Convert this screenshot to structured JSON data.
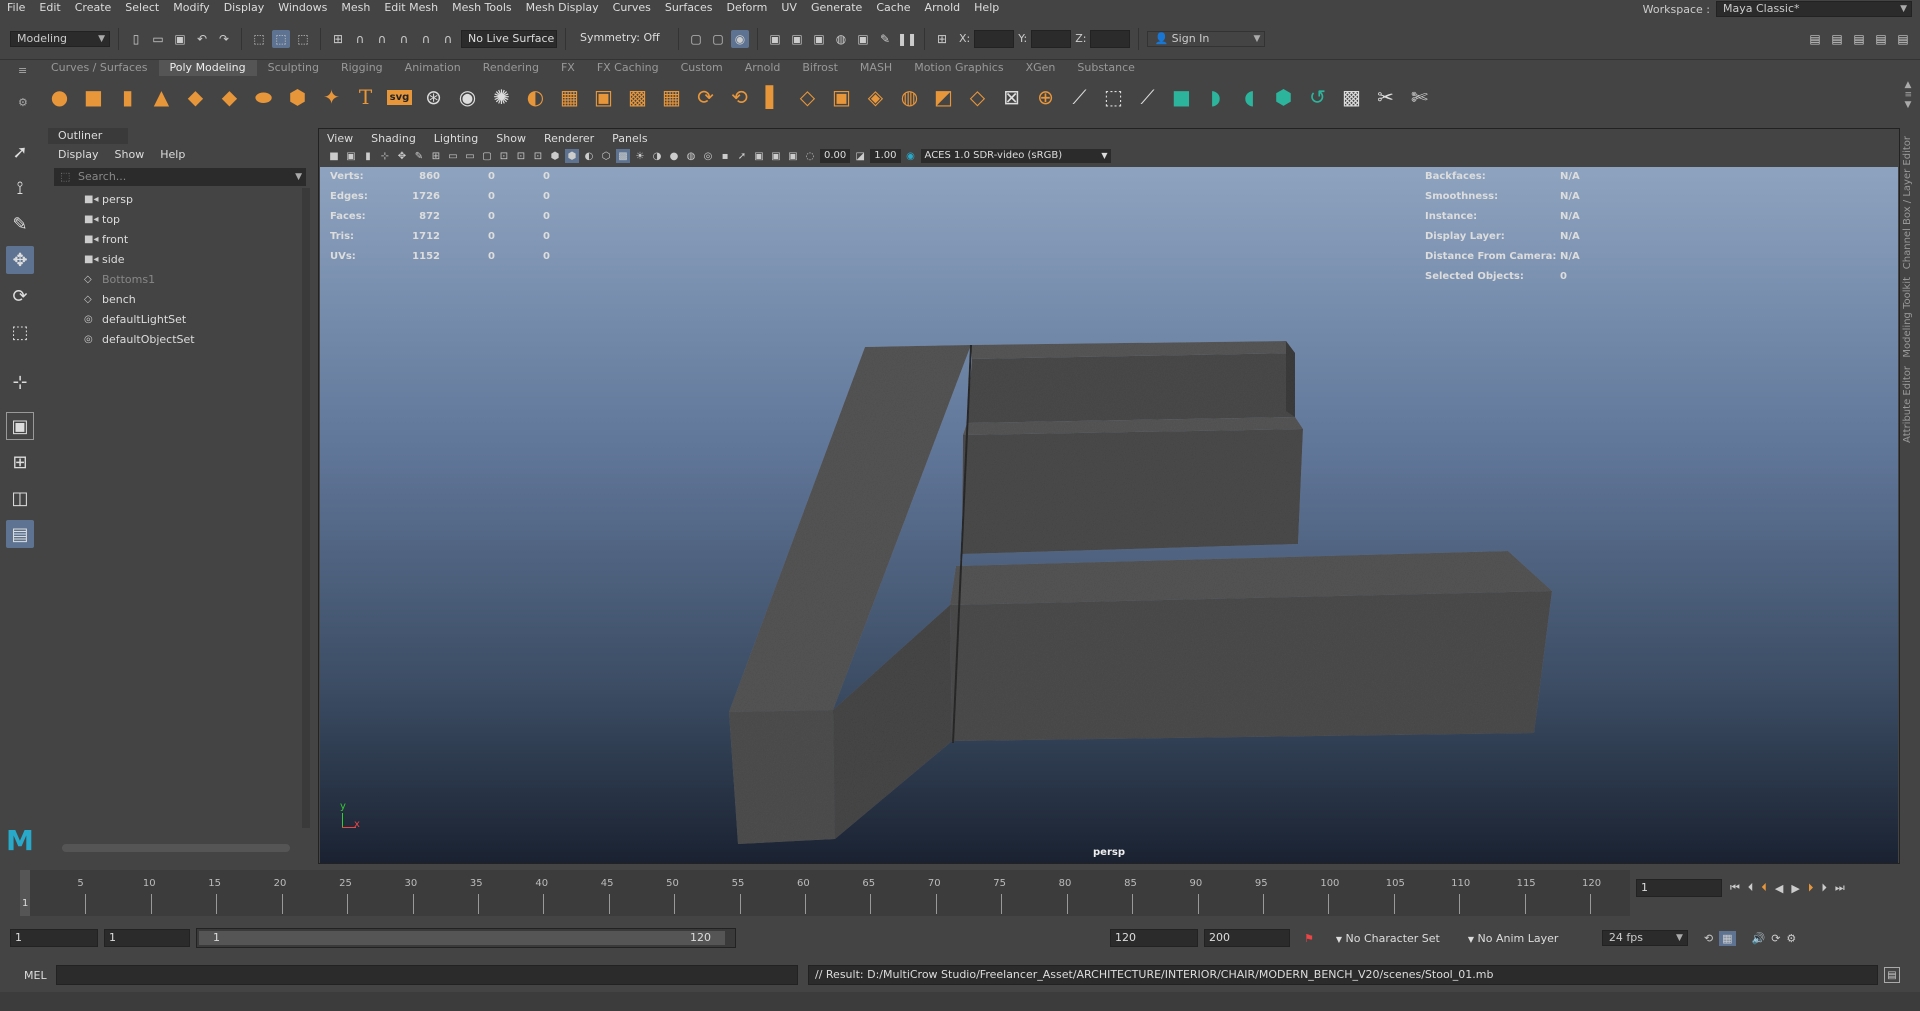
{
  "menubar": {
    "items": [
      "File",
      "Edit",
      "Create",
      "Select",
      "Modify",
      "Display",
      "Windows",
      "Mesh",
      "Edit Mesh",
      "Mesh Tools",
      "Mesh Display",
      "Curves",
      "Surfaces",
      "Deform",
      "UV",
      "Generate",
      "Cache",
      "Arnold",
      "Help"
    ],
    "workspace_label": "Workspace :",
    "workspace_value": "Maya Classic*"
  },
  "statusline": {
    "mode": "Modeling",
    "live_surface": "No Live Surface",
    "symmetry": "Symmetry: Off",
    "x_label": "X:",
    "y_label": "Y:",
    "z_label": "Z:",
    "sign_in": "Sign In"
  },
  "shelf": {
    "tabs": [
      "Curves / Surfaces",
      "Poly Modeling",
      "Sculpting",
      "Rigging",
      "Animation",
      "Rendering",
      "FX",
      "FX Caching",
      "Custom",
      "Arnold",
      "Bifrost",
      "MASH",
      "Motion Graphics",
      "XGen",
      "Substance"
    ],
    "active_tab": "Poly Modeling",
    "svg_label": "svg"
  },
  "outliner": {
    "title": "Outliner",
    "menu": [
      "Display",
      "Show",
      "Help"
    ],
    "search_placeholder": "Search...",
    "items": [
      {
        "label": "persp",
        "icon": "camera-icon",
        "dim": false
      },
      {
        "label": "top",
        "icon": "camera-icon",
        "dim": false
      },
      {
        "label": "front",
        "icon": "camera-icon",
        "dim": false
      },
      {
        "label": "side",
        "icon": "camera-icon",
        "dim": false
      },
      {
        "label": "Bottoms1",
        "icon": "group-icon",
        "dim": true
      },
      {
        "label": "bench",
        "icon": "group-icon",
        "dim": false
      },
      {
        "label": "defaultLightSet",
        "icon": "set-icon",
        "dim": false
      },
      {
        "label": "defaultObjectSet",
        "icon": "set-icon",
        "dim": false
      }
    ]
  },
  "viewport": {
    "menu": [
      "View",
      "Shading",
      "Lighting",
      "Show",
      "Renderer",
      "Panels"
    ],
    "exposure": "0.00",
    "gamma": "1.00",
    "colorspace": "ACES 1.0 SDR-video (sRGB)",
    "camera_label": "persp",
    "hud_left": [
      {
        "label": "Verts:",
        "v1": "860",
        "v2": "0",
        "v3": "0"
      },
      {
        "label": "Edges:",
        "v1": "1726",
        "v2": "0",
        "v3": "0"
      },
      {
        "label": "Faces:",
        "v1": "872",
        "v2": "0",
        "v3": "0"
      },
      {
        "label": "Tris:",
        "v1": "1712",
        "v2": "0",
        "v3": "0"
      },
      {
        "label": "UVs:",
        "v1": "1152",
        "v2": "0",
        "v3": "0"
      }
    ],
    "hud_right": [
      {
        "label": "Backfaces:",
        "value": "N/A"
      },
      {
        "label": "Smoothness:",
        "value": "N/A"
      },
      {
        "label": "Instance:",
        "value": "N/A"
      },
      {
        "label": "Display Layer:",
        "value": "N/A"
      },
      {
        "label": "Distance From Camera:",
        "value": "N/A"
      },
      {
        "label": "Selected Objects:",
        "value": "0"
      }
    ],
    "axis_y": "y",
    "axis_x": "x"
  },
  "timeline": {
    "ticks": [
      "5",
      "10",
      "15",
      "20",
      "25",
      "30",
      "35",
      "40",
      "45",
      "50",
      "55",
      "60",
      "65",
      "70",
      "75",
      "80",
      "85",
      "90",
      "95",
      "100",
      "105",
      "110",
      "115",
      "120"
    ],
    "start_tick": "1",
    "current_frame": "1"
  },
  "range": {
    "start": "1",
    "playback_start": "1",
    "slider_start": "1",
    "slider_end": "120",
    "playback_end": "120",
    "end": "200",
    "character_set": "No Character Set",
    "anim_layer": "No Anim Layer",
    "fps": "24 fps"
  },
  "cmdline": {
    "lang": "MEL",
    "result": "// Result: D:/MultiCrow Studio/Freelancer_Asset/ARCHITECTURE/INTERIOR/CHAIR/MODERN_BENCH_V20/scenes/Stool_01.mb"
  },
  "sidetabs": [
    "Channel Box / Layer Editor",
    "Modeling Toolkit",
    "Attribute Editor"
  ],
  "colors": {
    "accent": "#5d7391",
    "shelf_orange": "#e8963a",
    "shelf_green": "#2db49c"
  }
}
